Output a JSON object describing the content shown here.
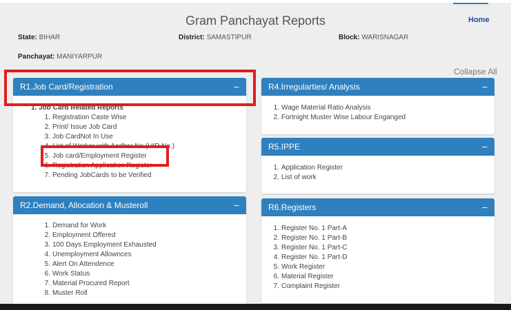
{
  "header": {
    "title": "Gram Panchayat Reports",
    "home": "Home",
    "state_label": "State:",
    "state_value": "BIHAR",
    "district_label": "District:",
    "district_value": "SAMASTIPUR",
    "block_label": "Block:",
    "block_value": "WARISNAGAR",
    "panchayat_label": "Panchayat:",
    "panchayat_value": "MANIYARPUR",
    "collapse_all": "Collapse All"
  },
  "panels": {
    "r1": {
      "title": "R1.Job Card/Registration",
      "toggle": "−",
      "group_num": "1.",
      "group_title": "Job Card Related Reports",
      "items": [
        "Registration Caste Wise",
        "Print/ Issue Job Card",
        "Job CardNot In Use",
        "List of Worker with Aadhar No.(UID No.)",
        "Job card/Employment Register",
        "Registration Application Register",
        "Pending JobCards to be Verified"
      ]
    },
    "r2": {
      "title": "R2.Demand, Allocation & Musteroll",
      "toggle": "−",
      "items": [
        "Demand for Work",
        "Employment Offered",
        "100 Days Employment Exhausted",
        "Unemployment Allownces",
        "Alert On Attendence",
        "Work Status",
        "Material Procured Report",
        "Muster Roll"
      ]
    },
    "r4": {
      "title": "R4.Irregularties/ Analysis",
      "toggle": "−",
      "items": [
        "Wage Material Ratio Analysis",
        "Fortnight Muster Wise Labour Enganged"
      ]
    },
    "r5": {
      "title": "R5.IPPE",
      "toggle": "−",
      "items": [
        "Application Register",
        "List of work"
      ]
    },
    "r6": {
      "title": "R6.Registers",
      "toggle": "−",
      "items": [
        "Register No. 1 Part-A",
        "Register No. 1 Part-B",
        "Register No. 1 Part-C",
        "Register No. 1 Part-D",
        "Work Register",
        "Material Register",
        "Complaint Register"
      ]
    }
  },
  "colors": {
    "panel_header": "#2f80be",
    "highlight": "#e01d1d",
    "link": "#1a4fa0"
  }
}
